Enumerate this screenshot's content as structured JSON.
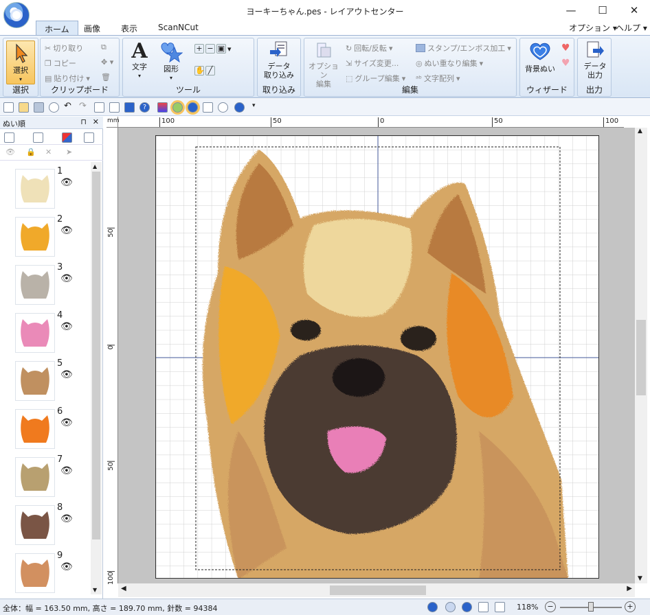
{
  "window": {
    "title": "ヨーキーちゃん.pes - レイアウトセンター",
    "minimize": "—",
    "maximize": "☐",
    "close": "✕"
  },
  "tabs": [
    "ホーム",
    "画像",
    "表示",
    "ScanNCut"
  ],
  "menu_right": {
    "options": "オプション",
    "help": "ヘルプ"
  },
  "ribbon": {
    "select_group": {
      "label": "選択",
      "button": "選択"
    },
    "clipboard_group": {
      "label": "クリップボード",
      "cut": "切り取り",
      "copy": "コピー",
      "paste": "貼り付け"
    },
    "tools_group": {
      "label": "ツール",
      "text": "文字",
      "shape": "図形"
    },
    "import_group": {
      "label": "取り込み",
      "import": "データ",
      "import2": "取り込み"
    },
    "edit_group": {
      "label": "編集",
      "option_edit": "オプション",
      "option_edit2": "編集",
      "rotate": "回転/反転",
      "resize": "サイズ変更...",
      "group_edit": "グループ編集",
      "stamp": "スタンプ/エンボス加工",
      "overlap": "ぬい重なり編集",
      "text_arrange": "文字配列"
    },
    "wizard_group": {
      "label": "ウィザード",
      "bg": "背景ぬい"
    },
    "output_group": {
      "label": "出力",
      "out": "データ",
      "out2": "出力"
    }
  },
  "side_panel": {
    "title": "ぬい順",
    "items": [
      {
        "num": "1",
        "color": "#efe1b8"
      },
      {
        "num": "2",
        "color": "#f0a92a"
      },
      {
        "num": "3",
        "color": "#b9b2a8"
      },
      {
        "num": "4",
        "color": "#ea8ab8"
      },
      {
        "num": "5",
        "color": "#c09060"
      },
      {
        "num": "6",
        "color": "#f07a1e"
      },
      {
        "num": "7",
        "color": "#b8a070"
      },
      {
        "num": "8",
        "color": "#7a5545"
      },
      {
        "num": "9",
        "color": "#d29060"
      }
    ]
  },
  "ruler_top": [
    "mm",
    "100",
    "50",
    "0",
    "50",
    "100"
  ],
  "ruler_left": [
    "50",
    "0",
    "50",
    "100"
  ],
  "status": {
    "text": "全体：幅 = 163.50 mm, 高さ = 189.70 mm, 針数 = 94384",
    "zoom": "118%"
  },
  "colors": {
    "accent": "#2a62c9",
    "ribbon_bg": "#dde8f6",
    "grid": "#cfcfcf"
  }
}
